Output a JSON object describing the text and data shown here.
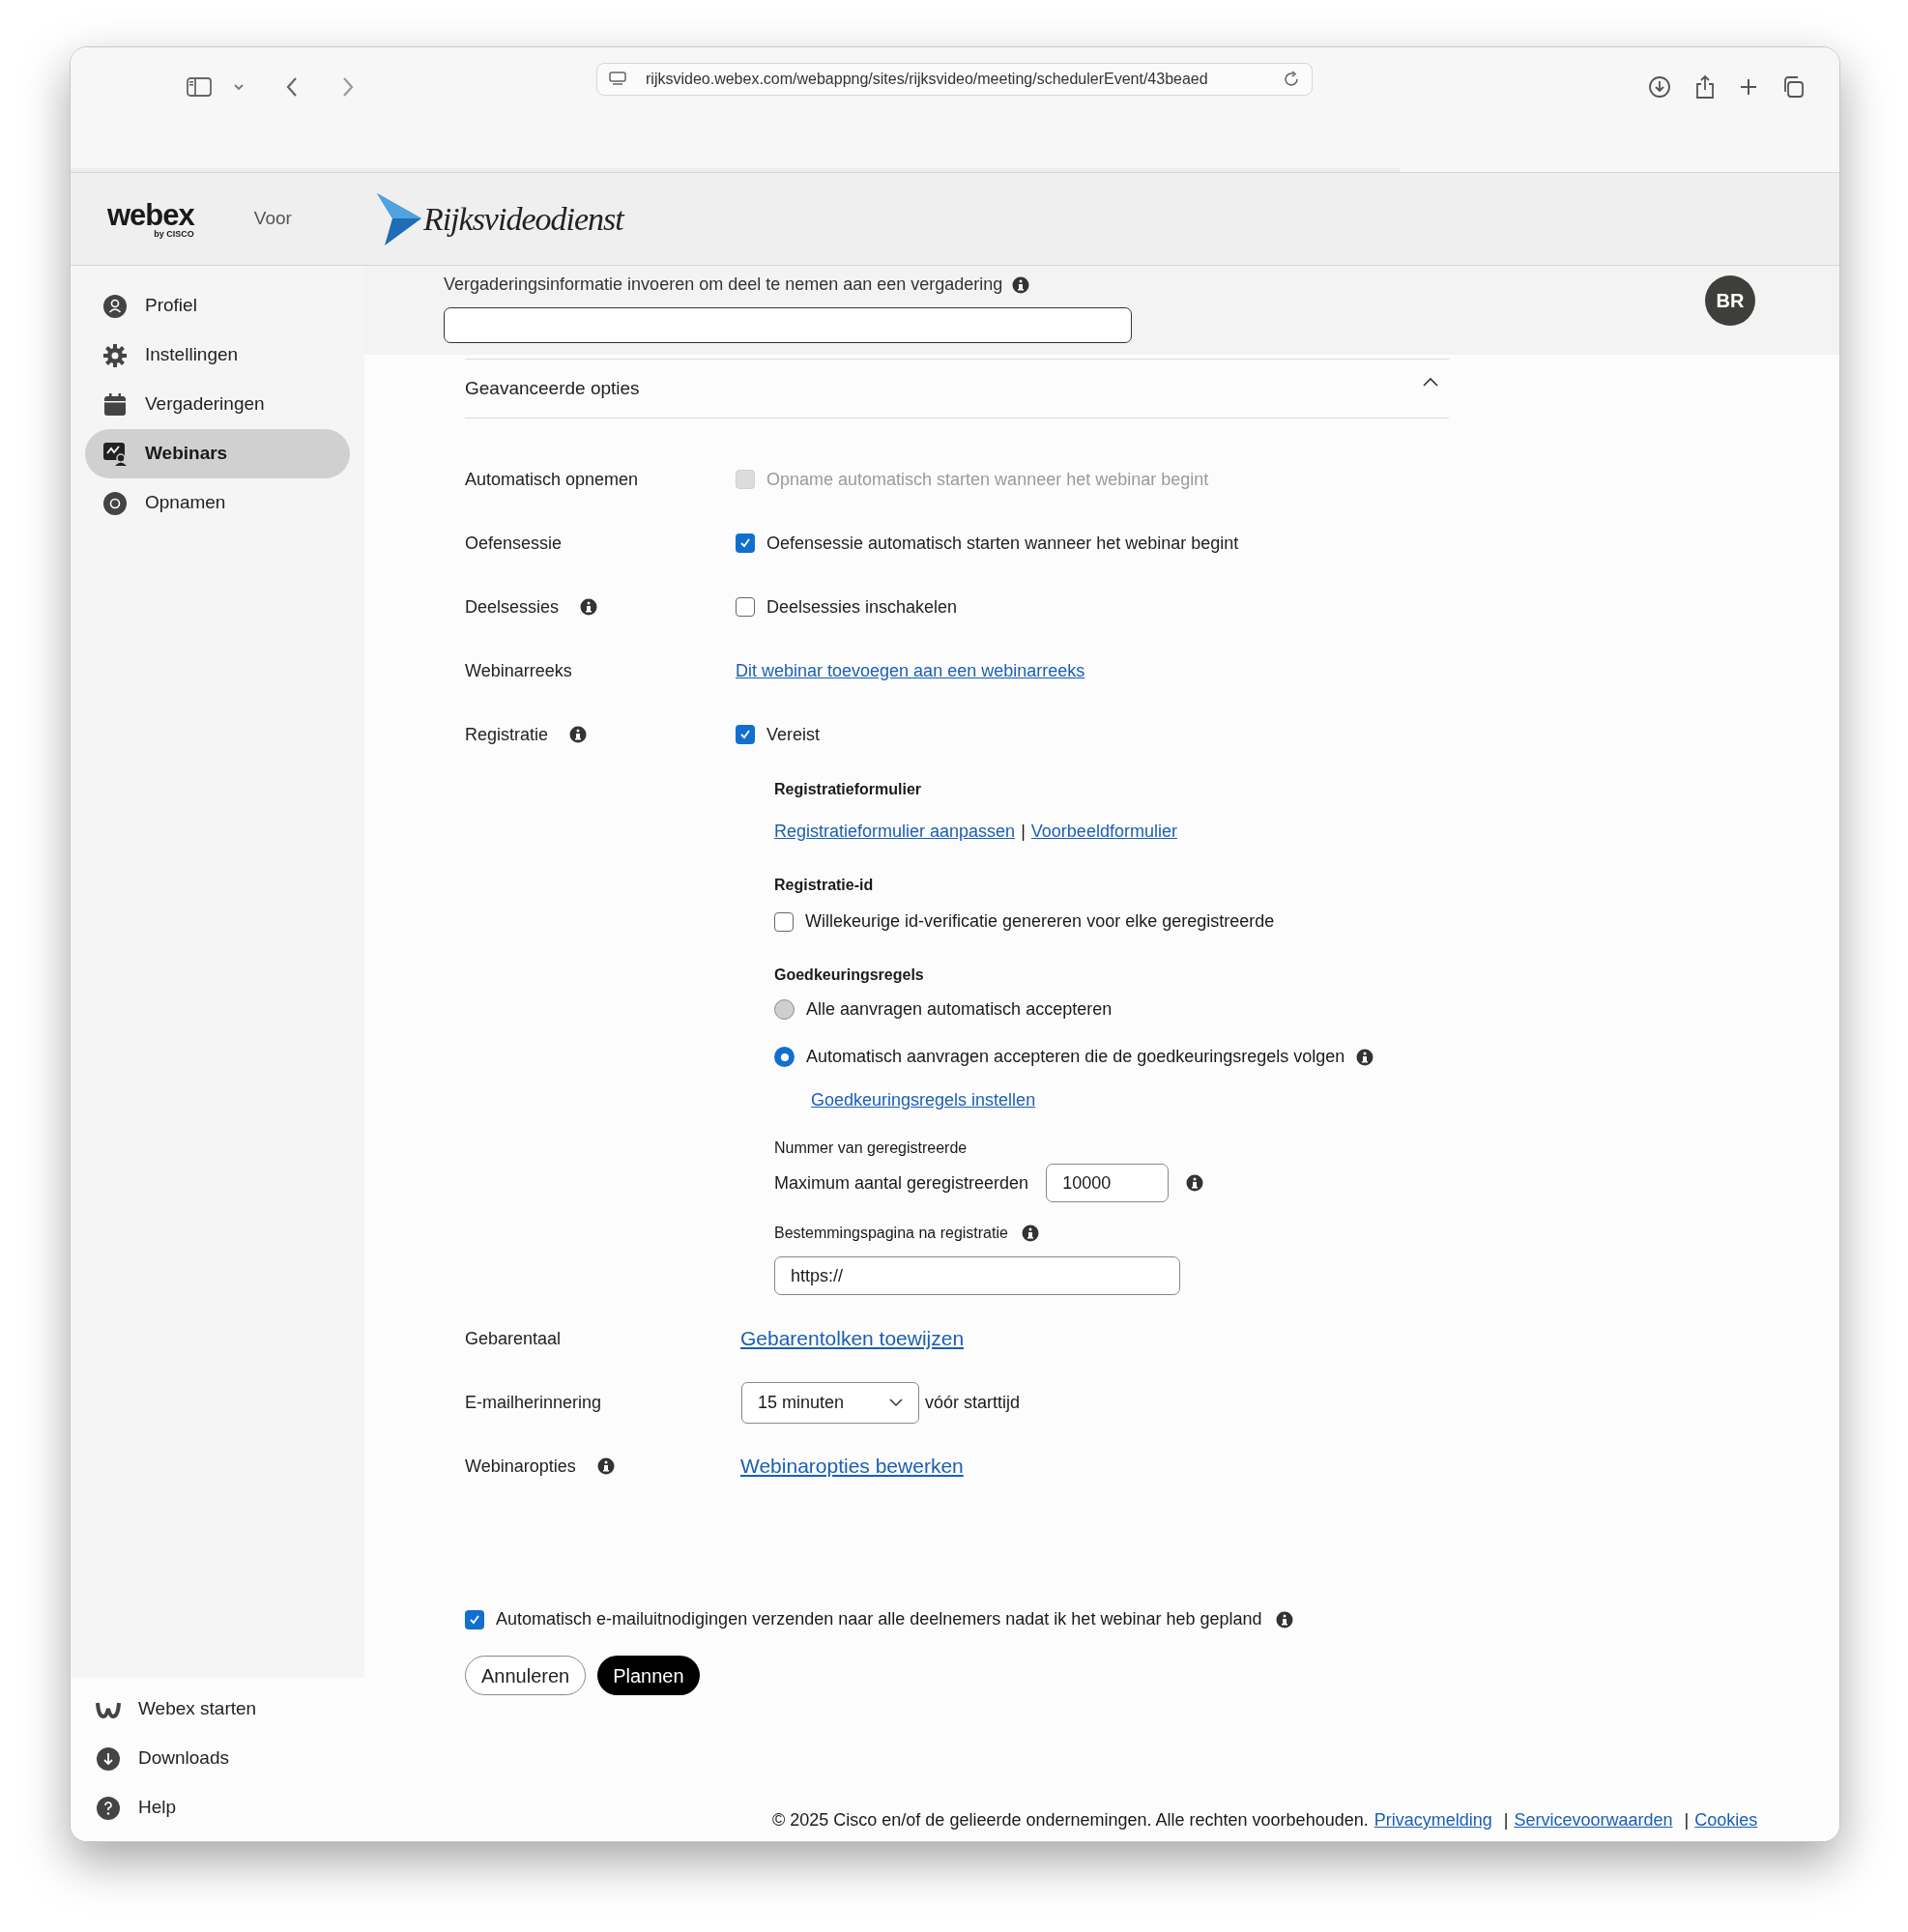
{
  "browser": {
    "url": "rijksvideo.webex.com/webappng/sites/rijksvideo/meeting/schedulerEvent/43beaed"
  },
  "header": {
    "logo": "webex",
    "logo_sub": "by CISCO",
    "voor": "Voor",
    "brand": "Rijksvideodienst"
  },
  "join": {
    "label": "Vergaderingsinformatie invoeren om deel te nemen aan een vergadering",
    "info": true
  },
  "avatar": "BR",
  "sidebar": {
    "items": [
      {
        "label": "Profiel",
        "selected": false
      },
      {
        "label": "Instellingen",
        "selected": false
      },
      {
        "label": "Vergaderingen",
        "selected": false
      },
      {
        "label": "Webinars",
        "selected": true
      },
      {
        "label": "Opnamen",
        "selected": false
      }
    ],
    "bottom": [
      {
        "label": "Webex starten"
      },
      {
        "label": "Downloads"
      },
      {
        "label": "Help"
      }
    ]
  },
  "section": {
    "title": "Geavanceerde opties",
    "expanded": true
  },
  "options": [
    {
      "label": "Automatisch opnemen",
      "info": false,
      "kind": "checkbox",
      "text": "Opname automatisch starten wanneer het webinar begint",
      "checked": false,
      "disabled": true
    },
    {
      "label": "Oefensessie",
      "info": false,
      "kind": "checkbox",
      "text": "Oefensessie automatisch starten wanneer het webinar begint",
      "checked": true,
      "disabled": false
    },
    {
      "label": "Deelsessies",
      "info": true,
      "kind": "checkbox",
      "text": "Deelsessies inschakelen",
      "checked": false,
      "disabled": false
    },
    {
      "label": "Webinarreeks",
      "info": false,
      "kind": "link",
      "text": "Dit webinar toevoegen aan een webinarreeks"
    },
    {
      "label": "Registratie",
      "info": true,
      "kind": "checkbox",
      "text": "Vereist",
      "checked": true,
      "disabled": false
    }
  ],
  "registration": {
    "form_heading": "Registratieformulier",
    "form_links": [
      "Registratieformulier aanpassen",
      "Voorbeeldformulier"
    ],
    "separator": "|",
    "id_heading": "Registratie-id",
    "id_checkbox": {
      "text": "Willekeurige id-verificatie genereren voor elke geregistreerde",
      "checked": false
    },
    "approval_heading": "Goedkeuringsregels",
    "approval_options": [
      {
        "text": "Alle aanvragen automatisch accepteren",
        "selected": false,
        "info": false
      },
      {
        "text": "Automatisch aanvragen accepteren die de goedkeuringsregels volgen",
        "selected": true,
        "info": true
      }
    ],
    "approval_link": "Goedkeuringsregels instellen",
    "number_heading": "Nummer van geregistreerde",
    "max_label": "Maximum aantal geregistreerden",
    "max_value": "10000",
    "destination_heading": "Bestemmingspagina na registratie",
    "destination_value": "https://"
  },
  "options2": [
    {
      "label": "Gebarentaal",
      "info": false,
      "kind": "link",
      "text": "Gebarentolken toewijzen"
    },
    {
      "label": "E-mailherinnering",
      "info": false,
      "kind": "select",
      "value": "15 minuten",
      "suffix": "vóór starttijd"
    },
    {
      "label": "Webinaropties",
      "info": true,
      "kind": "link",
      "text": "Webinaropties bewerken"
    }
  ],
  "invite": {
    "text": "Automatisch e-mailuitnodigingen verzenden naar alle deelnemers nadat ik het webinar heb gepland",
    "checked": true,
    "info": true
  },
  "buttons": [
    {
      "label": "Annuleren",
      "kind": "secondary"
    },
    {
      "label": "Plannen",
      "kind": "primary"
    }
  ],
  "footer": {
    "text": "© 2025 Cisco en/of de gelieerde ondernemingen. Alle rechten voorbehouden.",
    "links": [
      "Privacymelding",
      "Servicevoorwaarden",
      "Cookies"
    ],
    "separator": "|"
  }
}
